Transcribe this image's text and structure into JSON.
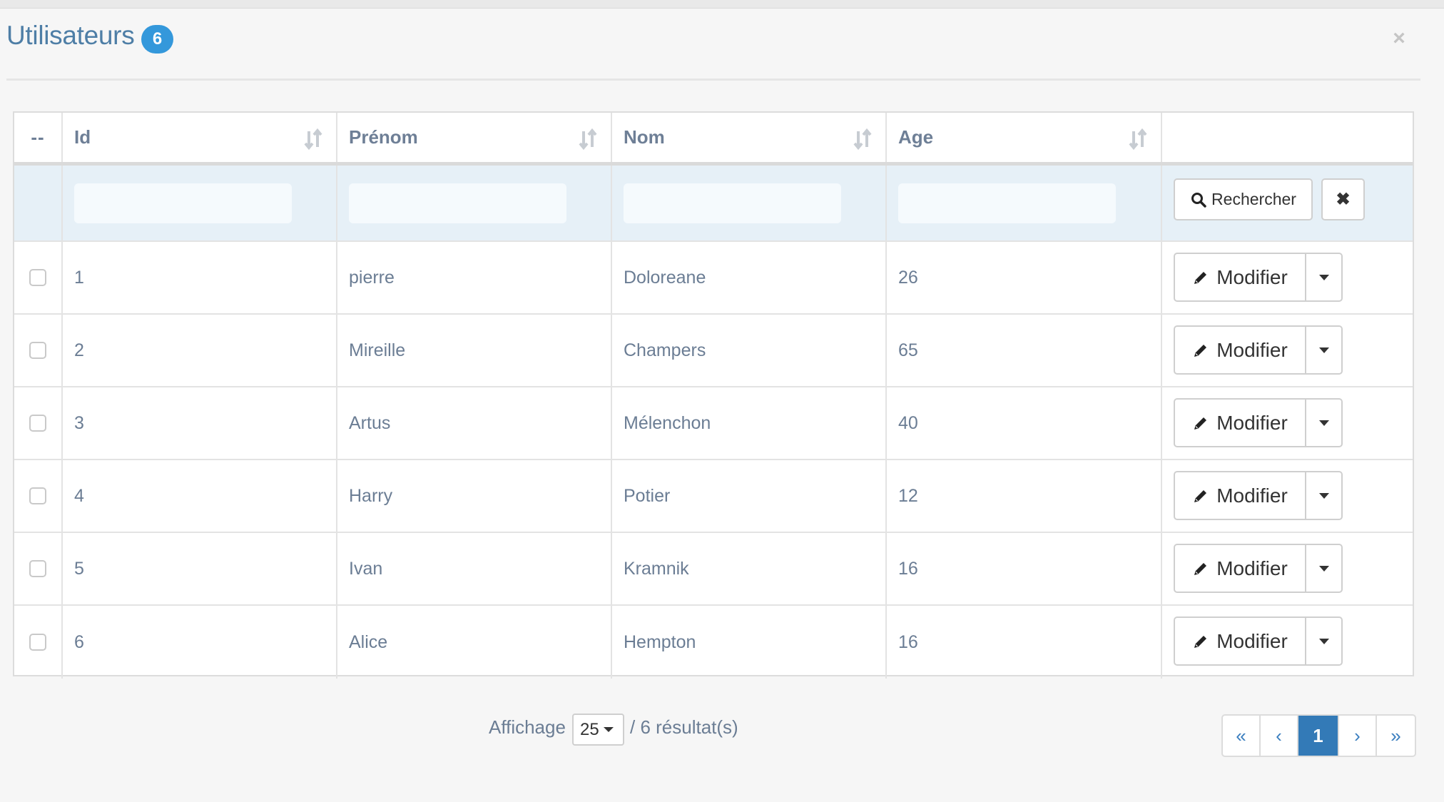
{
  "header": {
    "title": "Utilisateurs",
    "count_badge": "6",
    "close_glyph": "×"
  },
  "table": {
    "columns": [
      {
        "label": "--"
      },
      {
        "label": "Id",
        "sortable": true
      },
      {
        "label": "Prénom",
        "sortable": true
      },
      {
        "label": "Nom",
        "sortable": true
      },
      {
        "label": "Age",
        "sortable": true
      },
      {
        "label": ""
      }
    ],
    "filters": {
      "id": "",
      "prenom": "",
      "nom": "",
      "age": "",
      "search_label": "Rechercher",
      "clear_glyph": "✖"
    },
    "rows": [
      {
        "id": "1",
        "prenom": "pierre",
        "nom": "Doloreane",
        "age": "26"
      },
      {
        "id": "2",
        "prenom": "Mireille",
        "nom": "Champers",
        "age": "65"
      },
      {
        "id": "3",
        "prenom": "Artus",
        "nom": "Mélenchon",
        "age": "40"
      },
      {
        "id": "4",
        "prenom": "Harry",
        "nom": "Potier",
        "age": "12"
      },
      {
        "id": "5",
        "prenom": "Ivan",
        "nom": "Kramnik",
        "age": "16"
      },
      {
        "id": "6",
        "prenom": "Alice",
        "nom": "Hempton",
        "age": "16"
      }
    ],
    "row_action_label": "Modifier"
  },
  "footer": {
    "display_label": "Affichage",
    "page_size": "25",
    "results_text": "/ 6 résultat(s)"
  },
  "pagination": {
    "first": "«",
    "prev": "‹",
    "current": "1",
    "next": "›",
    "last": "»"
  },
  "colors": {
    "accent": "#337ab7",
    "badge": "#3498db",
    "title": "#4e7ea6",
    "filter_row_bg": "#e6f0f7"
  }
}
